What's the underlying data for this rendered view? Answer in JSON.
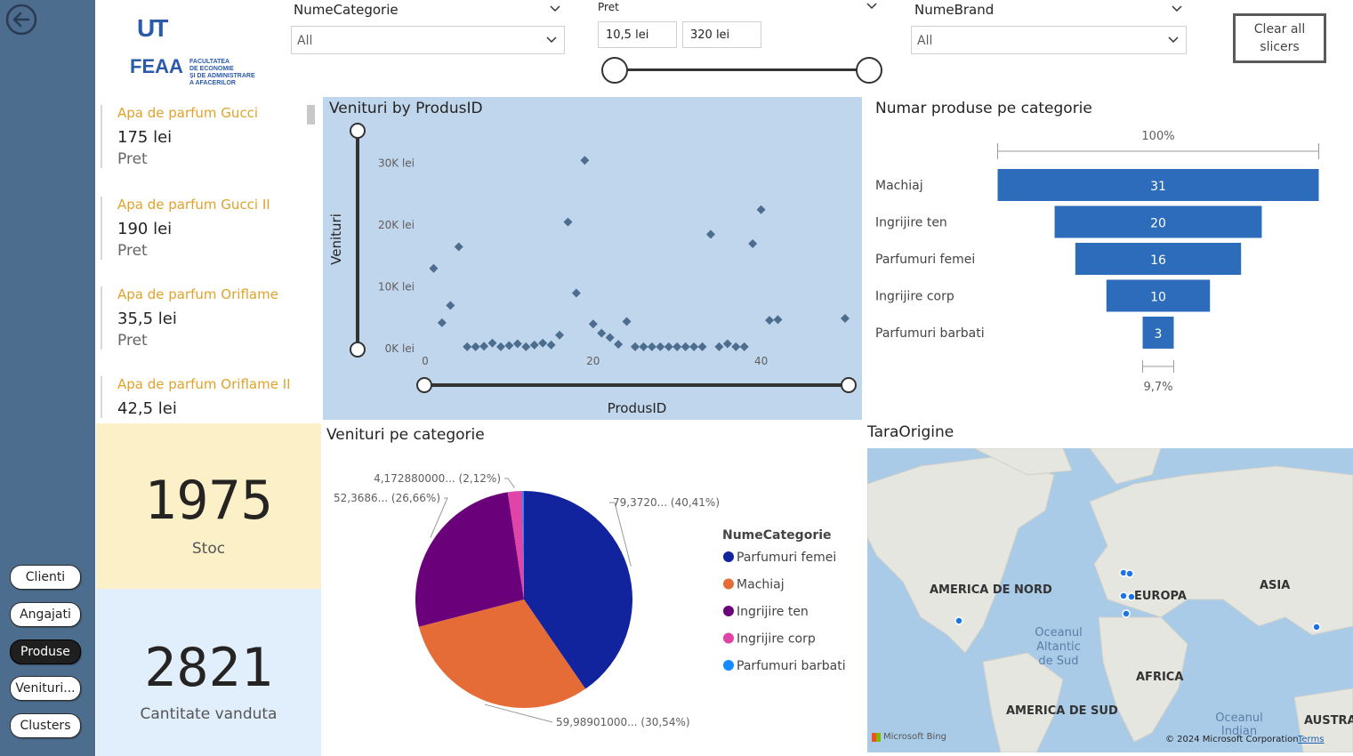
{
  "nav": {
    "back_icon": "back-arrow-icon",
    "buttons": [
      {
        "label": "Clienti",
        "active": false
      },
      {
        "label": "Angajati",
        "active": false
      },
      {
        "label": "Produse",
        "active": true
      },
      {
        "label": "Venituri...",
        "active": false
      },
      {
        "label": "Clusters",
        "active": false
      }
    ]
  },
  "logo": {
    "mark": "UT",
    "acronym": "FEAA",
    "line1": "FACULTATEA",
    "line2": "DE ECONOMIE",
    "line3": "ȘI DE ADMINISTRARE",
    "line4": "A AFACERILOR"
  },
  "slicers": {
    "categorie": {
      "title": "NumeCategorie",
      "value": "All"
    },
    "pret": {
      "title": "Pret",
      "min": "10,5 lei",
      "max": "320 lei"
    },
    "brand": {
      "title": "NumeBrand",
      "value": "All"
    },
    "clear_label": "Clear all slicers"
  },
  "products": [
    {
      "name": "Apa de parfum Gucci",
      "price": "175 lei",
      "label": "Pret"
    },
    {
      "name": "Apa de parfum Gucci II",
      "price": "190 lei",
      "label": "Pret"
    },
    {
      "name": "Apa de parfum Oriflame",
      "price": "35,5 lei",
      "label": "Pret"
    },
    {
      "name": "Apa de parfum Oriflame II",
      "price": "42,5 lei",
      "label": ""
    }
  ],
  "kpis": {
    "stoc": {
      "value": "1975",
      "label": "Stoc"
    },
    "cantitate": {
      "value": "2821",
      "label": "Cantitate vanduta"
    }
  },
  "chart_data": [
    {
      "type": "scatter",
      "title": "Venituri by ProdusID",
      "xlabel": "ProdusID",
      "ylabel": "Venituri",
      "xticks": [
        "0",
        "20",
        "40"
      ],
      "yticks": [
        "0K lei",
        "10K lei",
        "20K lei",
        "30K lei"
      ],
      "xlim": [
        0,
        50
      ],
      "ylim": [
        0,
        35000
      ],
      "marker_color": "#4d6d8f",
      "points": [
        [
          1,
          13000
        ],
        [
          2,
          4200
        ],
        [
          3,
          7000
        ],
        [
          4,
          16500
        ],
        [
          5,
          300
        ],
        [
          6,
          300
        ],
        [
          7,
          400
        ],
        [
          8,
          900
        ],
        [
          9,
          300
        ],
        [
          10,
          500
        ],
        [
          11,
          800
        ],
        [
          12,
          300
        ],
        [
          13,
          600
        ],
        [
          14,
          900
        ],
        [
          15,
          600
        ],
        [
          16,
          2200
        ],
        [
          17,
          20500
        ],
        [
          18,
          9000
        ],
        [
          19,
          30500
        ],
        [
          20,
          4000
        ],
        [
          21,
          2500
        ],
        [
          22,
          1800
        ],
        [
          23,
          700
        ],
        [
          24,
          4400
        ],
        [
          25,
          300
        ],
        [
          26,
          300
        ],
        [
          27,
          300
        ],
        [
          28,
          300
        ],
        [
          29,
          300
        ],
        [
          30,
          300
        ],
        [
          31,
          300
        ],
        [
          32,
          300
        ],
        [
          33,
          300
        ],
        [
          34,
          18500
        ],
        [
          35,
          300
        ],
        [
          36,
          800
        ],
        [
          37,
          300
        ],
        [
          38,
          300
        ],
        [
          39,
          17000
        ],
        [
          40,
          22500
        ],
        [
          41,
          4600
        ],
        [
          42,
          4700
        ],
        [
          50,
          4900
        ]
      ]
    },
    {
      "type": "bar",
      "title": "Numar produse pe categorie",
      "subtype": "funnel",
      "top_label": "100%",
      "bottom_label": "9,7%",
      "color": "#2d6cba",
      "categories": [
        "Machiaj",
        "Ingrijire ten",
        "Parfumuri femei",
        "Ingrijire corp",
        "Parfumuri barbati"
      ],
      "values": [
        31,
        20,
        16,
        10,
        3
      ]
    },
    {
      "type": "pie",
      "title": "Venituri pe categorie",
      "legend_title": "NumeCategorie",
      "slices": [
        {
          "name": "Parfumuri femei",
          "value": 40.41,
          "label": "79,3720... (40,41%)",
          "color": "#12239e"
        },
        {
          "name": "Machiaj",
          "value": 30.54,
          "label": "59,98901000... (30,54%)",
          "color": "#e66c37"
        },
        {
          "name": "Ingrijire ten",
          "value": 26.66,
          "label": "52,3686... (26,66%)",
          "color": "#6b007b"
        },
        {
          "name": "Ingrijire corp",
          "value": 2.12,
          "label": "4,172880000... (2,12%)",
          "color": "#e044a7"
        },
        {
          "name": "Parfumuri barbati",
          "value": 0.27,
          "label": "",
          "color": "#118dff"
        }
      ]
    }
  ],
  "map": {
    "title": "TaraOrigine",
    "labels": [
      "AMERICA DE NORD",
      "EUROPA",
      "ASIA",
      "Oceanul Altantic de Sud",
      "AFRICA",
      "AMERICA DE SUD",
      "Oceanul Indian",
      "AUSTRA"
    ],
    "bing": "Microsoft Bing",
    "copyright": "© 2024 Microsoft Corporation",
    "terms": "Terms"
  }
}
